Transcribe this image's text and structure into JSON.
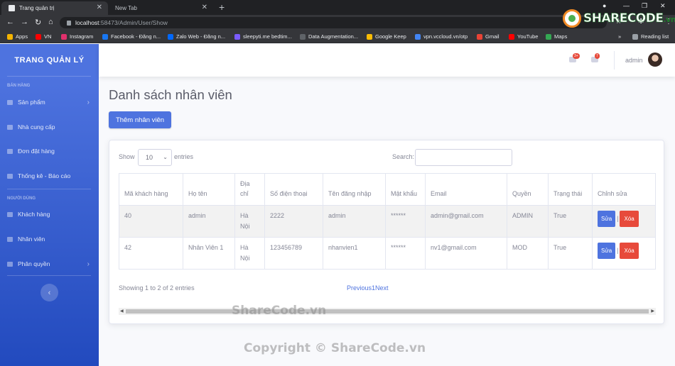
{
  "browser": {
    "tabs": [
      {
        "title": "Trang quản trị"
      },
      {
        "title": "New Tab"
      }
    ],
    "url_host": "localhost",
    "url_path": ":58473/Admin/User/Show",
    "bookmarks": [
      {
        "label": "Apps",
        "color": "#f4b400"
      },
      {
        "label": "VN",
        "color": "#ff0000"
      },
      {
        "label": "Instagram",
        "color": "#e1306c"
      },
      {
        "label": "Facebook - Đăng n...",
        "color": "#1877f2"
      },
      {
        "label": "Zalo Web - Đăng n...",
        "color": "#0068ff"
      },
      {
        "label": "sleepyti.me bedtim...",
        "color": "#7b5cff"
      },
      {
        "label": "Data Augmentation...",
        "color": "#5f6368"
      },
      {
        "label": "Google Keep",
        "color": "#fbbc04"
      },
      {
        "label": "vpn.vccloud.vn/otp",
        "color": "#4285f4"
      },
      {
        "label": "Gmail",
        "color": "#ea4335"
      },
      {
        "label": "YouTube",
        "color": "#ff0000"
      },
      {
        "label": "Maps",
        "color": "#34a853"
      },
      {
        "label": "Reading list",
        "color": "#9aa0a6"
      }
    ]
  },
  "sidebar": {
    "brand": "TRANG QUẢN LÝ",
    "heading_sales": "BÁN HÀNG",
    "heading_people": "NGƯỜI DÙNG",
    "items": [
      {
        "label": "Sản phẩm",
        "icon": "gear-icon"
      },
      {
        "label": "Nhà cung cấp",
        "icon": "chart-icon"
      },
      {
        "label": "Đơn đặt hàng",
        "icon": "chart-icon"
      },
      {
        "label": "Thống kê - Báo cáo",
        "icon": "table-icon"
      },
      {
        "label": "Khách hàng",
        "icon": "chart-icon"
      },
      {
        "label": "Nhân viên",
        "icon": "chart-icon"
      },
      {
        "label": "Phân quyền",
        "icon": "folder-icon"
      }
    ],
    "toggle": "‹"
  },
  "topbar": {
    "alerts_badge": "3+",
    "messages_badge": "7",
    "user": "admin"
  },
  "page": {
    "title": "Danh sách nhân viên",
    "add_button": "Thêm nhân viên"
  },
  "table_controls": {
    "show": "Show",
    "page_size": "10",
    "entries": "entries",
    "search": "Search:"
  },
  "table": {
    "columns": [
      "Mã khách hàng",
      "Họ tên",
      "Địa chỉ",
      "Số điện thoại",
      "Tên đăng nhập",
      "Mật khẩu",
      "Email",
      "Quyền",
      "Trạng thái",
      "Chỉnh sửa"
    ],
    "rows": [
      {
        "id": "40",
        "name": "admin",
        "address": "Hà Nội",
        "phone": "2222",
        "username": "admin",
        "password": "******",
        "email": "admin@gmail.com",
        "role": "ADMIN",
        "status": "True"
      },
      {
        "id": "42",
        "name": "Nhân Viên 1",
        "address": "Hà Nội",
        "phone": "123456789",
        "username": "nhanvien1",
        "password": "******",
        "email": "nv1@gmail.com",
        "role": "MOD",
        "status": "True"
      }
    ],
    "edit_label": "Sửa",
    "delete_label": "Xóa",
    "separator": "|"
  },
  "footer": {
    "info": "Showing 1 to 2 of 2 entries",
    "previous": "Previous",
    "current_page": "1",
    "next": "Next"
  },
  "watermarks": {
    "logo_main": "SHARECODE",
    "logo_suffix": ".vn",
    "center": "ShareCode.vn",
    "copyright": "Copyright © ShareCode.vn"
  }
}
